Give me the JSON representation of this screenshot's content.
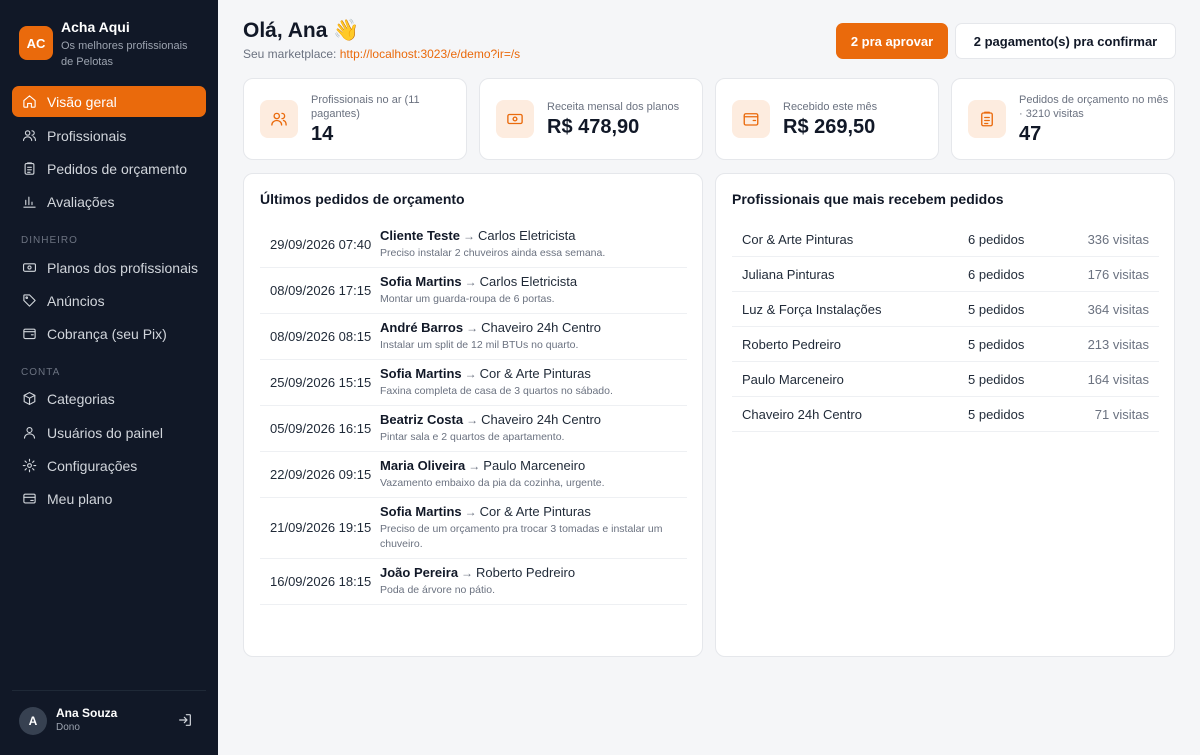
{
  "brand": {
    "logo": "AC",
    "name": "Acha Aqui",
    "tagline": "Os melhores profissionais de Pelotas",
    "accent": "#ea6a0c"
  },
  "nav": {
    "main": [
      {
        "label": "Visão geral",
        "icon": "home-icon",
        "active": true
      },
      {
        "label": "Profissionais",
        "icon": "users-icon"
      },
      {
        "label": "Pedidos de orçamento",
        "icon": "clipboard-icon"
      },
      {
        "label": "Avaliações",
        "icon": "bar-chart-icon"
      }
    ],
    "section_money": "DINHEIRO",
    "money": [
      {
        "label": "Planos dos profissionais",
        "icon": "money-icon"
      },
      {
        "label": "Anúncios",
        "icon": "tag-icon"
      },
      {
        "label": "Cobrança (seu Pix)",
        "icon": "wallet-icon"
      }
    ],
    "section_account": "CONTA",
    "account": [
      {
        "label": "Categorias",
        "icon": "box-icon"
      },
      {
        "label": "Usuários do painel",
        "icon": "user-icon"
      },
      {
        "label": "Configurações",
        "icon": "gear-icon"
      },
      {
        "label": "Meu plano",
        "icon": "card-icon"
      }
    ]
  },
  "user": {
    "initial": "A",
    "name": "Ana Souza",
    "role": "Dono"
  },
  "header": {
    "greeting": "Olá, Ana 👋",
    "marketplace_label": "Seu marketplace:",
    "marketplace_url": "http://localhost:3023/e/demo?ir=/s",
    "approve_button": "2 pra aprovar",
    "payments_button": "2 pagamento(s) pra confirmar"
  },
  "stats": [
    {
      "label": "Profissionais no ar (11 pagantes)",
      "value": "14",
      "icon": "users-icon"
    },
    {
      "label": "Receita mensal dos planos",
      "value": "R$ 478,90",
      "icon": "money-icon"
    },
    {
      "label": "Recebido este mês",
      "value": "R$ 269,50",
      "icon": "wallet-icon"
    },
    {
      "label": "Pedidos de orçamento no mês · 3210 visitas",
      "value": "47",
      "icon": "clipboard-icon"
    }
  ],
  "orders": {
    "title": "Últimos pedidos de orçamento",
    "arrow": "→",
    "items": [
      {
        "date": "29/09/2026 07:40",
        "client": "Cliente Teste",
        "pro": "Carlos Eletricista",
        "desc": "Preciso instalar 2 chuveiros ainda essa semana."
      },
      {
        "date": "08/09/2026 17:15",
        "client": "Sofia Martins",
        "pro": "Carlos Eletricista",
        "desc": "Montar um guarda-roupa de 6 portas."
      },
      {
        "date": "08/09/2026 08:15",
        "client": "André Barros",
        "pro": "Chaveiro 24h Centro",
        "desc": "Instalar um split de 12 mil BTUs no quarto."
      },
      {
        "date": "25/09/2026 15:15",
        "client": "Sofia Martins",
        "pro": "Cor & Arte Pinturas",
        "desc": "Faxina completa de casa de 3 quartos no sábado."
      },
      {
        "date": "05/09/2026 16:15",
        "client": "Beatriz Costa",
        "pro": "Chaveiro 24h Centro",
        "desc": "Pintar sala e 2 quartos de apartamento."
      },
      {
        "date": "22/09/2026 09:15",
        "client": "Maria Oliveira",
        "pro": "Paulo Marceneiro",
        "desc": "Vazamento embaixo da pia da cozinha, urgente."
      },
      {
        "date": "21/09/2026 19:15",
        "client": "Sofia Martins",
        "pro": "Cor & Arte Pinturas",
        "desc": "Preciso de um orçamento pra trocar 3 tomadas e instalar um chuveiro."
      },
      {
        "date": "16/09/2026 18:15",
        "client": "João Pereira",
        "pro": "Roberto Pedreiro",
        "desc": "Poda de árvore no pátio."
      }
    ]
  },
  "top_pros": {
    "title": "Profissionais que mais recebem pedidos",
    "items": [
      {
        "name": "Cor & Arte Pinturas",
        "orders": "6 pedidos",
        "visits": "336 visitas"
      },
      {
        "name": "Juliana Pinturas",
        "orders": "6 pedidos",
        "visits": "176 visitas"
      },
      {
        "name": "Luz & Força Instalações",
        "orders": "5 pedidos",
        "visits": "364 visitas"
      },
      {
        "name": "Roberto Pedreiro",
        "orders": "5 pedidos",
        "visits": "213 visitas"
      },
      {
        "name": "Paulo Marceneiro",
        "orders": "5 pedidos",
        "visits": "164 visitas"
      },
      {
        "name": "Chaveiro 24h Centro",
        "orders": "5 pedidos",
        "visits": "71 visitas"
      }
    ]
  }
}
